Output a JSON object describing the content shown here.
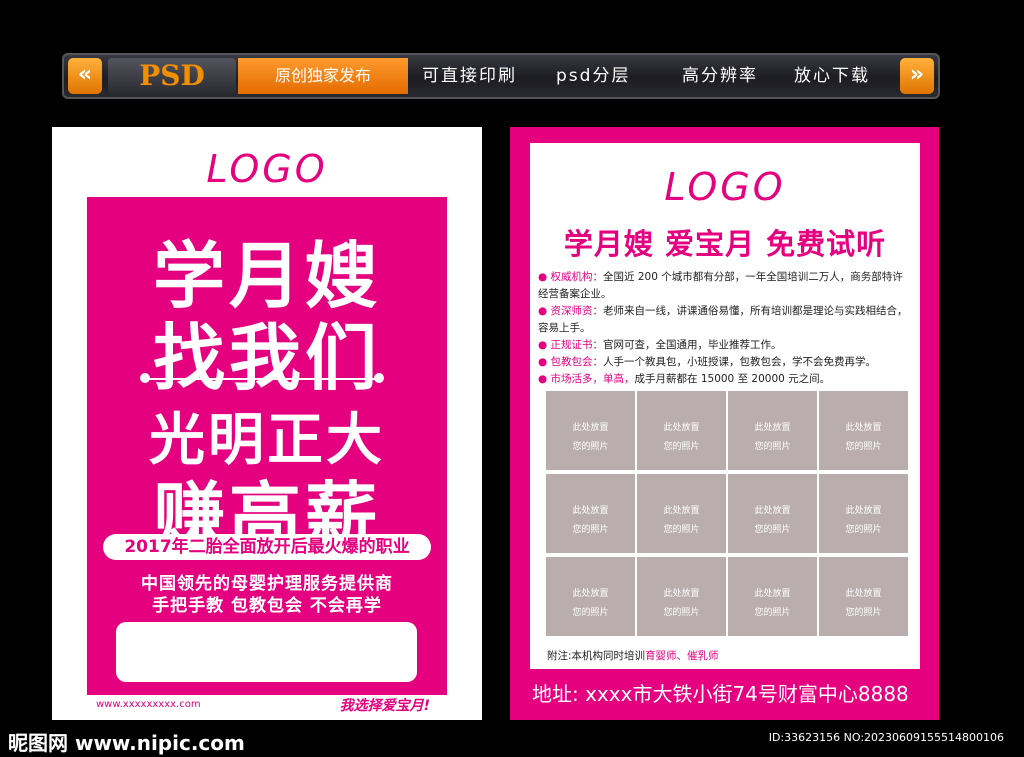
{
  "banner": {
    "psd_label": "PSD",
    "highlight_label": "原创独家发布",
    "features": [
      "可直接印刷",
      "psd分层",
      "高分辨率",
      "放心下载"
    ],
    "left_arrow": "«",
    "right_arrow": "»"
  },
  "left_flyer": {
    "logo": "LOGO",
    "hero_line1": "学月嫂",
    "hero_line2": "找我们",
    "hero_line3": "光明正大",
    "hero_line4": "赚高薪",
    "pill_text": "2017年二胎全面放开后最火爆的职业",
    "sub_line1": "中国领先的母婴护理服务提供商",
    "sub_line2": "手把手教  包教包会  不会再学",
    "url": "www.xxxxxxxxx.com",
    "slogan": "我选择爱宝月!"
  },
  "right_flyer": {
    "logo": "LOGO",
    "headline": "学月嫂 爱宝月 免费试听",
    "bullets": [
      {
        "key": "权威机构：",
        "text": "全国近 200 个城市都有分部，一年全国培训二万人，商务部特许经营备案企业。",
        "hl": ""
      },
      {
        "key": "资深师资：",
        "text": "老师来自一线，讲课通俗易懂，所有培训都是理论与实践相结合，容易上手。",
        "hl": ""
      },
      {
        "key": "正规证书：",
        "text": "官网可查，全国通用，毕业推荐工作。",
        "hl": ""
      },
      {
        "key": "包教包会：",
        "text": "人手一个教具包，小班授课，包教包会，学不会免费再学。",
        "hl": ""
      },
      {
        "key": "市场活多，单高，",
        "text": "成手月薪都在 15000 至 20000 元之间。",
        "hl": ""
      }
    ],
    "photo_line1": "此处放置",
    "photo_line2": "您的照片",
    "note_prefix": "附注:本机构同时培训",
    "note_highlight": "育婴师、催乳师",
    "address": "地址: xxxx市大铁小街74号财富中心8888"
  },
  "watermark": {
    "site": "昵图网 www.nipic.com",
    "id": "ID:33623156 NO:20230609155514800106"
  },
  "colors": {
    "brand_pink": "#e4007f",
    "photo_gray": "#b9adae",
    "banner_orange": "#f08a00"
  }
}
